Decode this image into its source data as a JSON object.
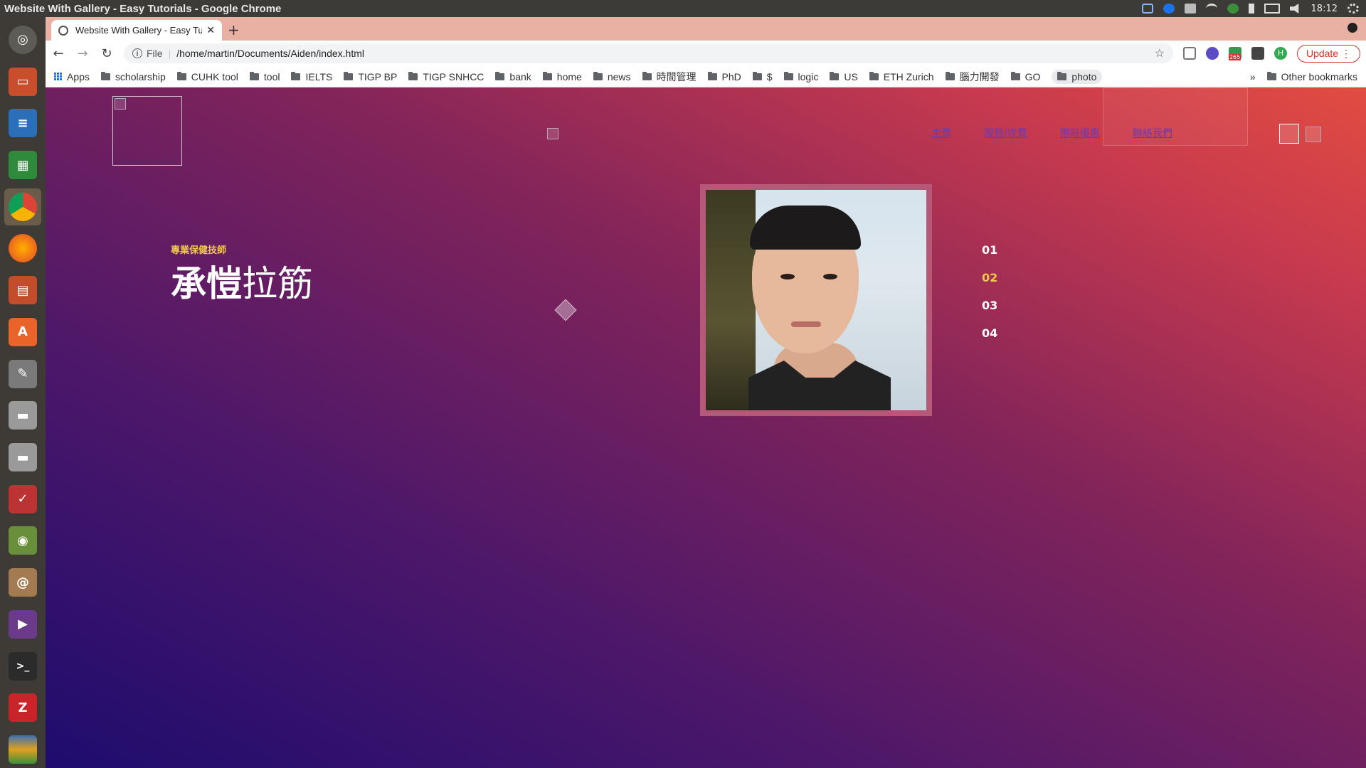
{
  "os": {
    "window_title": "Website With Gallery - Easy Tutorials - Google Chrome",
    "clock": "18:12"
  },
  "browser": {
    "tab_title": "Website With Gallery - Easy Tutorials",
    "tab_close": "✕",
    "new_tab": "+",
    "url_scheme": "File",
    "url": "/home/martin/Documents/Aiden/index.html",
    "update_label": "Update",
    "extension_badge": "265",
    "bookmarks": {
      "apps": "Apps",
      "items": [
        "scholarship",
        "CUHK tool",
        "tool",
        "IELTS",
        "TIGP BP",
        "TIGP SNHCC",
        "bank",
        "home",
        "news",
        "時間管理",
        "PhD",
        "$",
        "logic",
        "US",
        "ETH Zurich",
        "腦力開發",
        "GO",
        "photo"
      ],
      "more": "»",
      "other": "Other bookmarks"
    }
  },
  "page": {
    "nav": [
      "主頁",
      "服務/收費",
      "限時優惠",
      "聯絡我們"
    ],
    "hero": {
      "subtitle": "專業保健技師",
      "title_bold": "承愷",
      "title_rest": "拉筋"
    },
    "slides": [
      "01",
      "02",
      "03",
      "04"
    ],
    "active_slide": "02",
    "colors": {
      "accent": "#f3c94a",
      "gradient_dark": "#1e0c6e",
      "gradient_light": "#e24c41",
      "nav_link": "#6a3bb3"
    }
  }
}
